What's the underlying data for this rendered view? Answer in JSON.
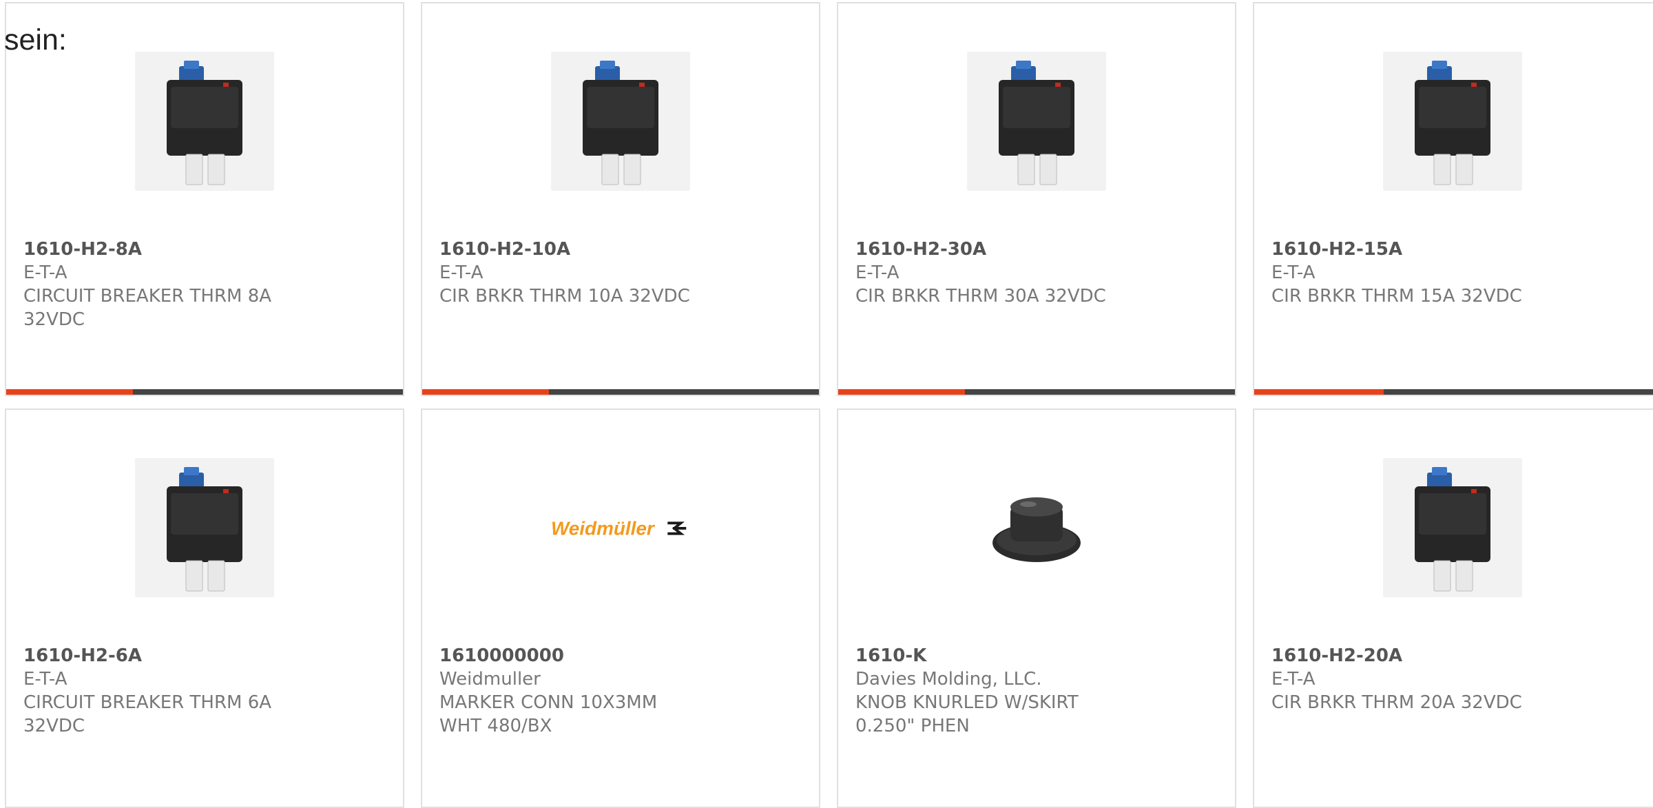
{
  "intro_text": "sein:",
  "colors": {
    "accent": "#e8421a",
    "bar": "#444444",
    "card_border": "#e0e0e0",
    "weidmuller_orange": "#f39a1e"
  },
  "products": [
    {
      "part_number": "1610-H2-8A",
      "manufacturer": "E-T-A",
      "description": "CIRCUIT BREAKER THRM 8A 32VDC",
      "image": "circuit-breaker-image",
      "progress": 0.32
    },
    {
      "part_number": "1610-H2-10A",
      "manufacturer": "E-T-A",
      "description": "CIR BRKR THRM 10A 32VDC",
      "image": "circuit-breaker-image",
      "progress": 0.32
    },
    {
      "part_number": "1610-H2-30A",
      "manufacturer": "E-T-A",
      "description": "CIR BRKR THRM 30A 32VDC",
      "image": "circuit-breaker-image",
      "progress": 0.32
    },
    {
      "part_number": "1610-H2-15A",
      "manufacturer": "E-T-A",
      "description": "CIR BRKR THRM 15A 32VDC",
      "image": "circuit-breaker-image",
      "progress": 0.32
    },
    {
      "part_number": "1610-H2-6A",
      "manufacturer": "E-T-A",
      "description": "CIRCUIT BREAKER THRM 6A 32VDC",
      "image": "circuit-breaker-image"
    },
    {
      "part_number": "1610000000",
      "manufacturer": "Weidmuller",
      "description": "MARKER CONN 10X3MM WHT 480/BX",
      "image": "weidmuller-logo",
      "logo_text": "Weidmüller"
    },
    {
      "part_number": "1610-K",
      "manufacturer": "Davies Molding, LLC.",
      "description": "KNOB KNURLED W/SKIRT 0.250\" PHEN",
      "image": "knob-image"
    },
    {
      "part_number": "1610-H2-20A",
      "manufacturer": "E-T-A",
      "description": "CIR BRKR THRM 20A 32VDC",
      "image": "circuit-breaker-image"
    }
  ]
}
